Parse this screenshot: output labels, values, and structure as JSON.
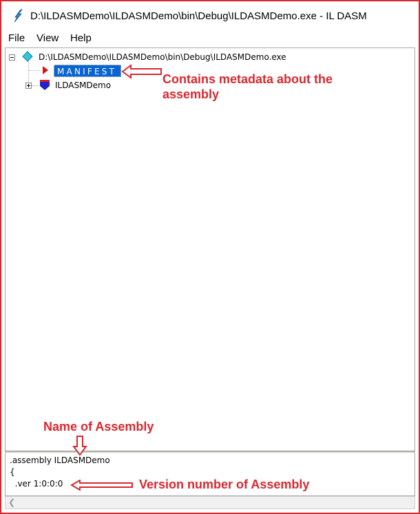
{
  "window": {
    "title": "D:\\ILDASMDemo\\ILDASMDemo\\bin\\Debug\\ILDASMDemo.exe - IL DASM"
  },
  "menu": {
    "file": "File",
    "view": "View",
    "help": "Help"
  },
  "tree": {
    "root_label": "D:\\ILDASMDemo\\ILDASMDemo\\bin\\Debug\\ILDASMDemo.exe",
    "manifest_label": "MANIFEST",
    "namespace_label": "ILDASMDemo"
  },
  "detail": {
    "line1": ".assembly ILDASMDemo",
    "line2": "{",
    "line3": "  .ver 1:0:0:0"
  },
  "annotations": {
    "manifest_note_line1": "Contains metadata about the",
    "manifest_note_line2": "assembly",
    "name_note": "Name of Assembly",
    "version_note": "Version number of Assembly"
  },
  "colors": {
    "annotation": "#d9272e",
    "selection": "#0a64d4"
  }
}
